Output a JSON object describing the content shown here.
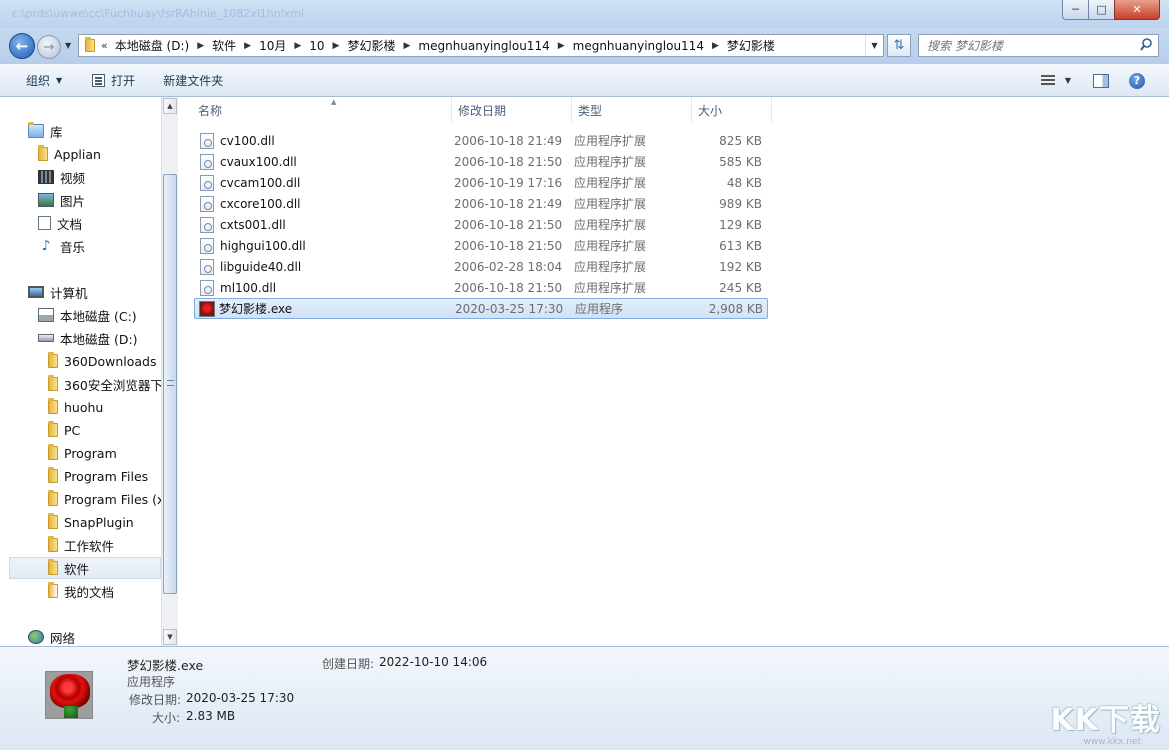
{
  "window": {
    "title": "c:\\prds\\uwwe\\cc\\Fuchhuay\\fsrRAhinie_1082xl1hnlxml"
  },
  "address": {
    "crumbs": [
      "本地磁盘 (D:)",
      "软件",
      "10月",
      "10",
      "梦幻影楼",
      "megnhuanyinglou114",
      "megnhuanyinglou114",
      "梦幻影楼"
    ]
  },
  "search": {
    "placeholder": "搜索 梦幻影楼"
  },
  "toolbar": {
    "organize": "组织",
    "open": "打开",
    "new_folder": "新建文件夹"
  },
  "nav": {
    "items": [
      {
        "label": "库",
        "icon": "library-icon"
      },
      {
        "label": "Applian",
        "icon": "folder-icon"
      },
      {
        "label": "视频",
        "icon": "video-icon"
      },
      {
        "label": "图片",
        "icon": "pictures-icon"
      },
      {
        "label": "文档",
        "icon": "documents-icon"
      },
      {
        "label": "音乐",
        "icon": "music-icon"
      },
      {
        "label": "计算机",
        "icon": "computer-icon"
      },
      {
        "label": "本地磁盘 (C:)",
        "icon": "drive-c-icon"
      },
      {
        "label": "本地磁盘 (D:)",
        "icon": "drive-d-icon"
      },
      {
        "label": "360Downloads",
        "icon": "folder-icon"
      },
      {
        "label": "360安全浏览器下",
        "icon": "folder-icon"
      },
      {
        "label": "huohu",
        "icon": "folder-icon"
      },
      {
        "label": "PC",
        "icon": "folder-icon"
      },
      {
        "label": "Program",
        "icon": "folder-icon"
      },
      {
        "label": "Program Files",
        "icon": "folder-icon"
      },
      {
        "label": "Program Files (x",
        "icon": "folder-icon"
      },
      {
        "label": "SnapPlugin",
        "icon": "folder-icon"
      },
      {
        "label": "工作软件",
        "icon": "folder-icon"
      },
      {
        "label": "软件",
        "icon": "folder-icon"
      },
      {
        "label": "我的文档",
        "icon": "folder-icon"
      },
      {
        "label": "网络",
        "icon": "network-icon"
      }
    ],
    "selected": "软件"
  },
  "columns": {
    "name": "名称",
    "date": "修改日期",
    "type": "类型",
    "size": "大小"
  },
  "files": [
    {
      "name": "cv100.dll",
      "date": "2006-10-18 21:49",
      "type": "应用程序扩展",
      "size": "825 KB",
      "icon": "dll-file-icon"
    },
    {
      "name": "cvaux100.dll",
      "date": "2006-10-18 21:50",
      "type": "应用程序扩展",
      "size": "585 KB",
      "icon": "dll-file-icon"
    },
    {
      "name": "cvcam100.dll",
      "date": "2006-10-19 17:16",
      "type": "应用程序扩展",
      "size": "48 KB",
      "icon": "dll-file-icon"
    },
    {
      "name": "cxcore100.dll",
      "date": "2006-10-18 21:49",
      "type": "应用程序扩展",
      "size": "989 KB",
      "icon": "dll-file-icon"
    },
    {
      "name": "cxts001.dll",
      "date": "2006-10-18 21:50",
      "type": "应用程序扩展",
      "size": "129 KB",
      "icon": "dll-file-icon"
    },
    {
      "name": "highgui100.dll",
      "date": "2006-10-18 21:50",
      "type": "应用程序扩展",
      "size": "613 KB",
      "icon": "dll-file-icon"
    },
    {
      "name": "libguide40.dll",
      "date": "2006-02-28 18:04",
      "type": "应用程序扩展",
      "size": "192 KB",
      "icon": "dll-file-icon"
    },
    {
      "name": "ml100.dll",
      "date": "2006-10-18 21:50",
      "type": "应用程序扩展",
      "size": "245 KB",
      "icon": "dll-file-icon"
    },
    {
      "name": "梦幻影楼.exe",
      "date": "2020-03-25 17:30",
      "type": "应用程序",
      "size": "2,908 KB",
      "icon": "rose-exe-icon"
    }
  ],
  "details": {
    "filename": "梦幻影楼.exe",
    "kind": "应用程序",
    "modified_label": "修改日期:",
    "modified": "2020-03-25 17:30",
    "size_label": "大小:",
    "size": "2.83 MB",
    "created_label": "创建日期:",
    "created": "2022-10-10 14:06"
  },
  "watermark": {
    "text": "KK下载",
    "url": "www.kkx.net"
  },
  "colors": {
    "selection": "#cfe2f8",
    "selection_border": "#84acdd",
    "toolbar_text": "#1e395b",
    "close_button": "#c7402a"
  }
}
